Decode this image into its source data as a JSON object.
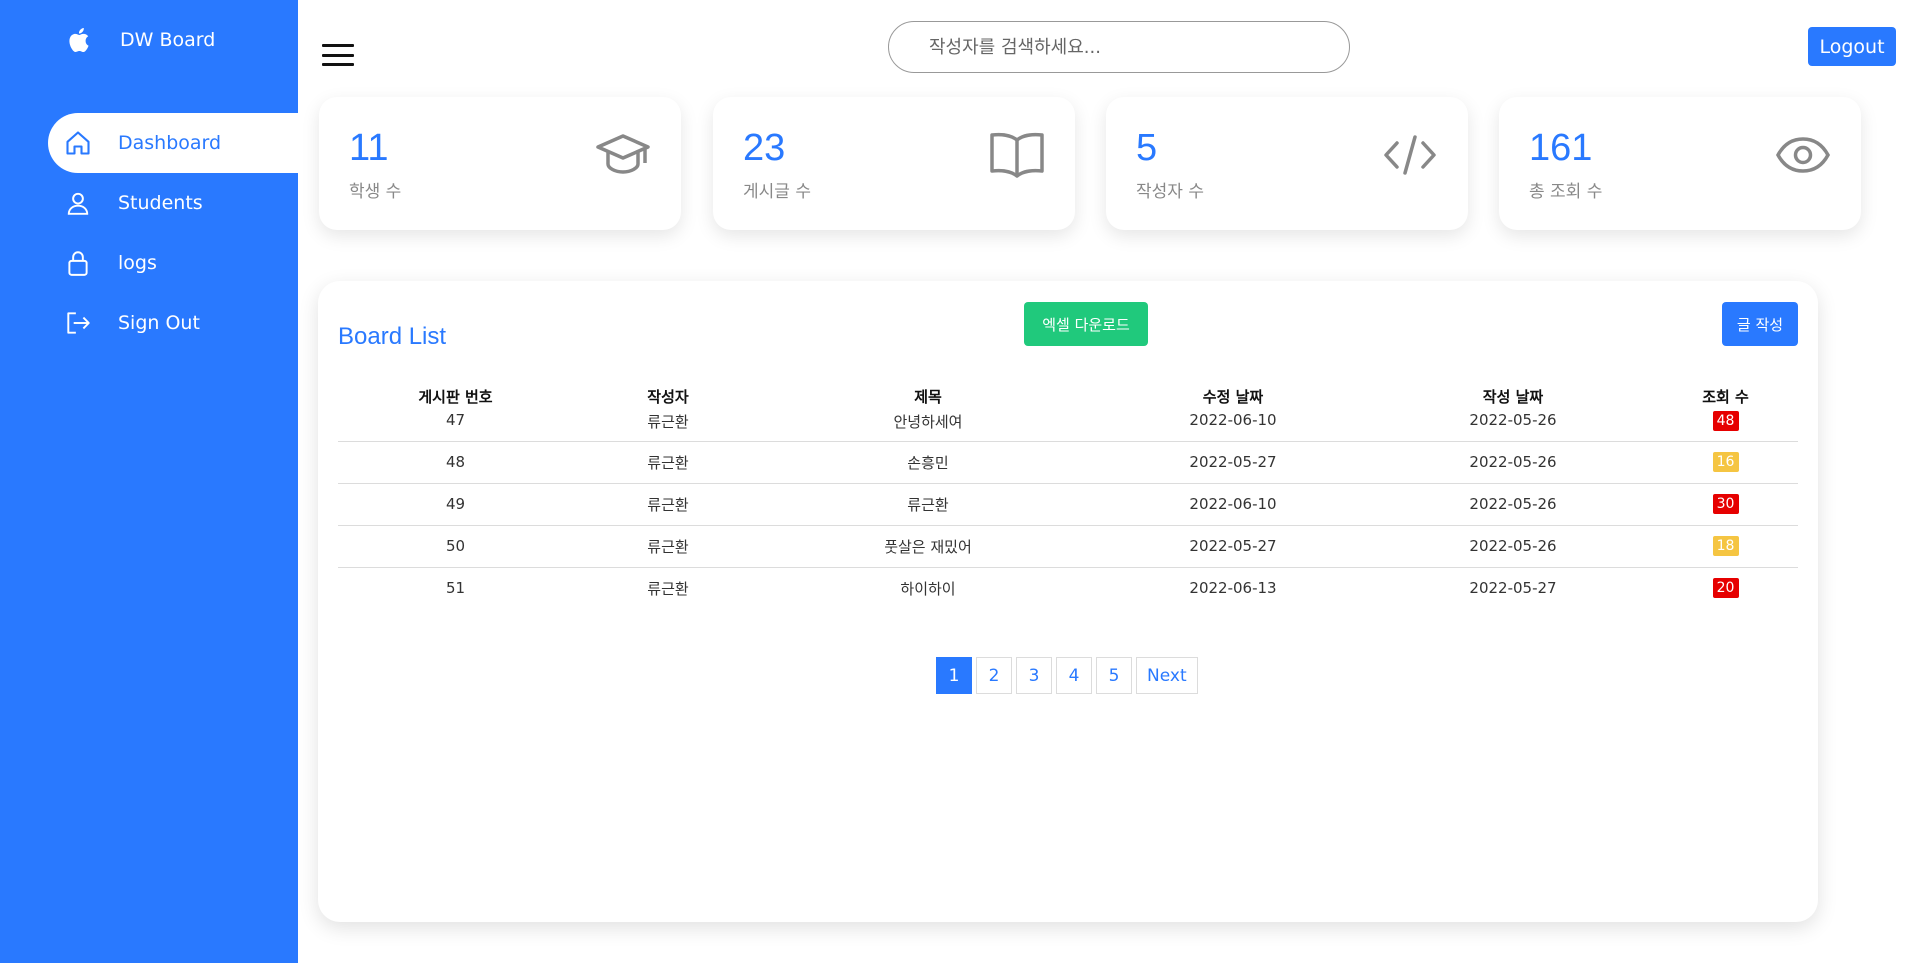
{
  "brand": {
    "name": "DW Board"
  },
  "nav": [
    {
      "label": "Dashboard",
      "icon": "home-icon",
      "active": true
    },
    {
      "label": "Students",
      "icon": "user-icon",
      "active": false
    },
    {
      "label": "logs",
      "icon": "lock-icon",
      "active": false
    },
    {
      "label": "Sign Out",
      "icon": "sign-out-icon",
      "active": false
    }
  ],
  "header": {
    "search_placeholder": "작성자를 검색하세요...",
    "logout_label": "Logout"
  },
  "stats": [
    {
      "value": "11",
      "caption": "학생 수",
      "icon": "graduation-cap-icon"
    },
    {
      "value": "23",
      "caption": "게시글 수",
      "icon": "book-icon"
    },
    {
      "value": "5",
      "caption": "작성자 수",
      "icon": "code-icon"
    },
    {
      "value": "161",
      "caption": "총 조회 수",
      "icon": "eye-icon"
    }
  ],
  "board": {
    "title": "Board List",
    "excel_label": "엑셀 다운로드",
    "write_label": "글 작성",
    "columns": [
      "게시판 번호",
      "작성자",
      "제목",
      "수정 날짜",
      "작성 날짜",
      "조회 수"
    ],
    "rows": [
      {
        "id": "47",
        "author": "류근환",
        "title": "안녕하세여",
        "updated": "2022-06-10",
        "created": "2022-05-26",
        "views": "48",
        "level": "red"
      },
      {
        "id": "48",
        "author": "류근환",
        "title": "손흥민",
        "updated": "2022-05-27",
        "created": "2022-05-26",
        "views": "16",
        "level": "yellow"
      },
      {
        "id": "49",
        "author": "류근환",
        "title": "류근환",
        "updated": "2022-06-10",
        "created": "2022-05-26",
        "views": "30",
        "level": "red"
      },
      {
        "id": "50",
        "author": "류근환",
        "title": "풋살은 재밌어",
        "updated": "2022-05-27",
        "created": "2022-05-26",
        "views": "18",
        "level": "yellow"
      },
      {
        "id": "51",
        "author": "류근환",
        "title": "하이하이",
        "updated": "2022-06-13",
        "created": "2022-05-27",
        "views": "20",
        "level": "red"
      }
    ],
    "pagination": {
      "pages": [
        "1",
        "2",
        "3",
        "4",
        "5"
      ],
      "current": "1",
      "next_label": "Next"
    }
  },
  "colors": {
    "primary": "#2979ff",
    "excel": "#20c97c",
    "badge_red": "#e60000",
    "badge_yellow": "#f5c542"
  }
}
